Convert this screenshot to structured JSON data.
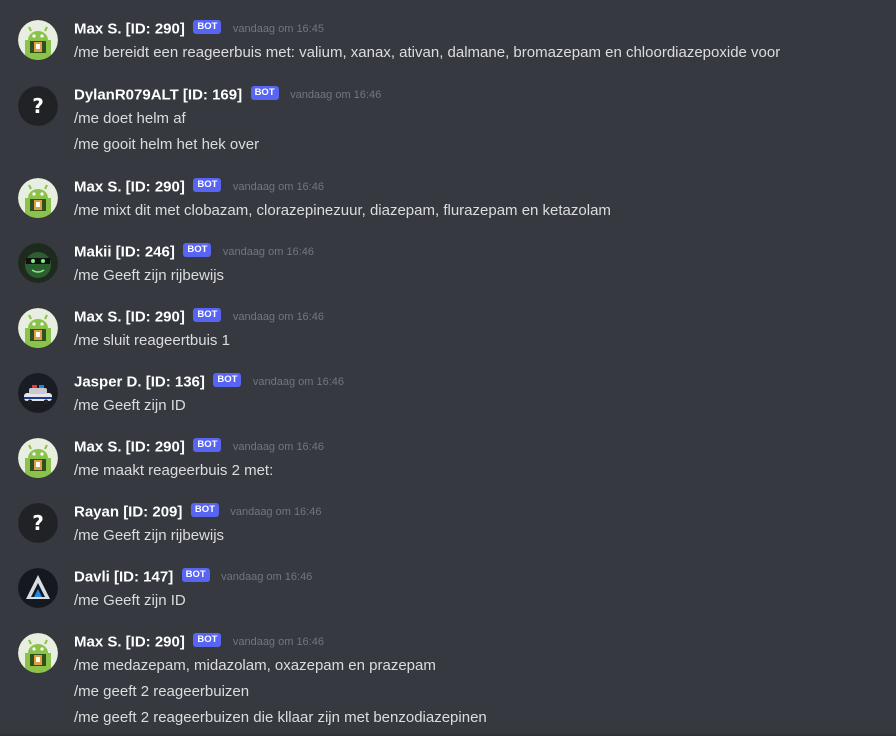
{
  "bot_tag": "BOT",
  "colors": {
    "background": "#36393f",
    "bot_tag": "#5865f2",
    "username": "#ffffff",
    "text": "#dcddde",
    "timestamp": "#72767d"
  },
  "messages": [
    {
      "author": "Max S. [ID: 290]",
      "avatar": "android-avatar-icon",
      "time": "vandaag om 16:45",
      "lines": [
        "/me bereidt een reageerbuis met: valium, xanax, ativan, dalmane, bromazepam en chloordiazepoxide voor"
      ]
    },
    {
      "author": "DylanR079ALT [ID: 169]",
      "avatar": "question-mark-avatar-icon",
      "time": "vandaag om 16:46",
      "lines": [
        "/me doet helm af",
        "/me gooit helm het hek over"
      ]
    },
    {
      "author": "Max S. [ID: 290]",
      "avatar": "android-avatar-icon",
      "time": "vandaag om 16:46",
      "lines": [
        "/me mixt dit met clobazam, clorazepinezuur, diazepam, flurazepam en ketazolam"
      ]
    },
    {
      "author": "Makii [ID: 246]",
      "avatar": "green-mask-avatar-icon",
      "time": "vandaag om 16:46",
      "lines": [
        "/me Geeft zijn rijbewijs"
      ]
    },
    {
      "author": "Max S. [ID: 290]",
      "avatar": "android-avatar-icon",
      "time": "vandaag om 16:46",
      "lines": [
        "/me sluit reageertbuis 1"
      ]
    },
    {
      "author": "Jasper D. [ID: 136]",
      "avatar": "police-car-avatar-icon",
      "time": "vandaag om 16:46",
      "lines": [
        "/me Geeft zijn ID"
      ]
    },
    {
      "author": "Max S. [ID: 290]",
      "avatar": "android-avatar-icon",
      "time": "vandaag om 16:46",
      "lines": [
        "/me maakt reageerbuis 2 met:"
      ]
    },
    {
      "author": "Rayan [ID: 209]",
      "avatar": "question-mark-avatar-icon",
      "time": "vandaag om 16:46",
      "lines": [
        "/me Geeft zijn rijbewijs"
      ]
    },
    {
      "author": "Davli [ID: 147]",
      "avatar": "triangle-logo-avatar-icon",
      "time": "vandaag om 16:46",
      "lines": [
        "/me Geeft zijn ID"
      ]
    },
    {
      "author": "Max S. [ID: 290]",
      "avatar": "android-avatar-icon",
      "time": "vandaag om 16:46",
      "lines": [
        "/me medazepam, midazolam, oxazepam en prazepam",
        "/me geeft 2 reageerbuizen",
        "/me geeft 2 reageerbuizen die kllaar zijn met benzodiazepinen"
      ]
    }
  ]
}
